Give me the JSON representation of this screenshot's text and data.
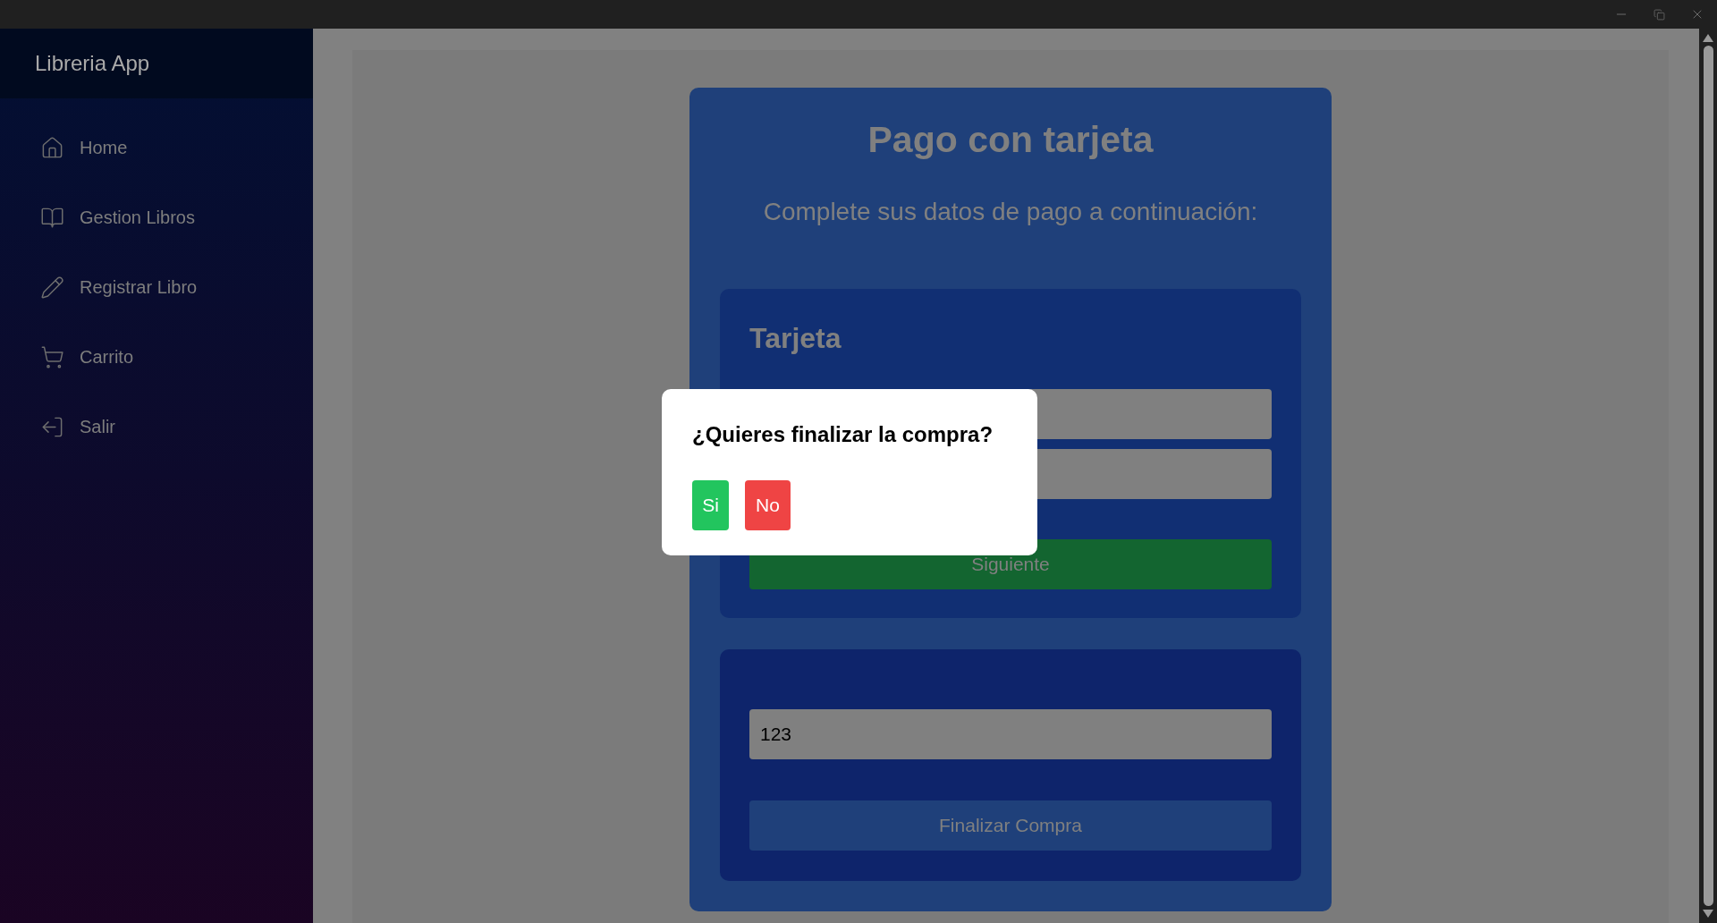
{
  "sidebar": {
    "title": "Libreria App",
    "items": [
      {
        "label": "Home",
        "kind": "home"
      },
      {
        "label": "Gestion Libros",
        "kind": "book"
      },
      {
        "label": "Registrar Libro",
        "kind": "pencil"
      },
      {
        "label": "Carrito",
        "kind": "cart"
      },
      {
        "label": "Salir",
        "kind": "exit"
      }
    ]
  },
  "page": {
    "title": "Pago con tarjeta",
    "subtitle": "Complete sus datos de pago a continuación:"
  },
  "card_section": {
    "title": "Tarjeta",
    "button": "Siguiente"
  },
  "confirm_section": {
    "field_value": "123",
    "button": "Finalizar Compra"
  },
  "dialog": {
    "question": "¿Quieres finalizar la compra?",
    "buttons": [
      {
        "label": "Si",
        "kind": "confirm"
      },
      {
        "label": "No",
        "kind": "cancel"
      }
    ]
  }
}
